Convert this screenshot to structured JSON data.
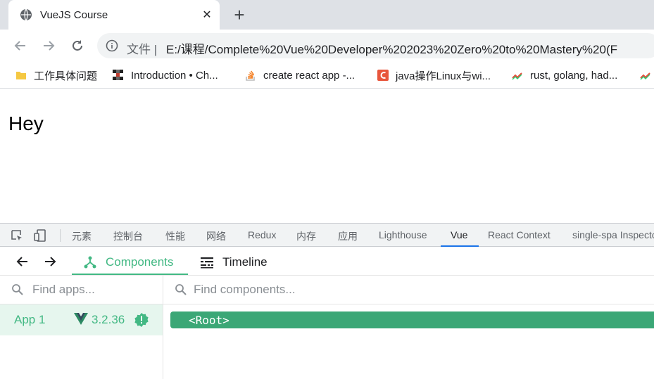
{
  "browser": {
    "tab": {
      "title": "VueJS Course",
      "close": "✕"
    },
    "new_tab": "+",
    "address": {
      "scheme_label": "文件 |",
      "url": "E:/课程/Complete%20Vue%20Developer%202023%20Zero%20to%20Mastery%20(F"
    },
    "bookmarks": [
      {
        "label": "工作具体问题",
        "icon": "folder-icon"
      },
      {
        "label": "Introduction • Ch...",
        "icon": "checker-icon"
      },
      {
        "label": "create react app -...",
        "icon": "stackoverflow-icon"
      },
      {
        "label": "java操作Linux与wi...",
        "icon": "csdn-icon"
      },
      {
        "label": "rust, golang, had...",
        "icon": "trend-icon"
      }
    ]
  },
  "page": {
    "text": "Hey"
  },
  "devtools": {
    "tabs": [
      "元素",
      "控制台",
      "性能",
      "网络",
      "Redux",
      "内存",
      "应用",
      "Lighthouse",
      "Vue",
      "React Context",
      "single-spa Inspector"
    ],
    "active_tab": "Vue"
  },
  "vue": {
    "tabs": [
      {
        "label": "Components",
        "active": true
      },
      {
        "label": "Timeline",
        "active": false
      }
    ],
    "apps_search_placeholder": "Find apps...",
    "components_search_placeholder": "Find components...",
    "app": {
      "name": "App 1",
      "version": "3.2.36"
    },
    "tree": {
      "root_label": "<Root>"
    },
    "colors": {
      "accent": "#42b883",
      "selected_bg": "#e6f6ee",
      "root_row": "#3ba776"
    }
  }
}
